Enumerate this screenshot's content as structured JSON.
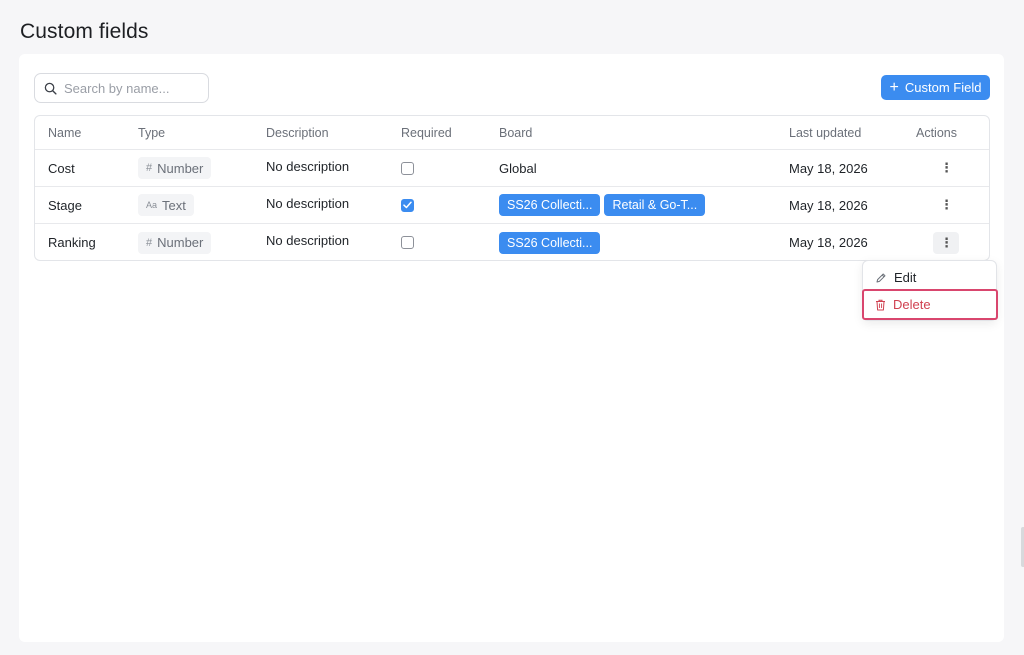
{
  "page": {
    "title": "Custom fields"
  },
  "toolbar": {
    "search_placeholder": "Search by name...",
    "add_button_label": "Custom Field"
  },
  "table": {
    "columns": {
      "name": "Name",
      "type": "Type",
      "description": "Description",
      "required": "Required",
      "board": "Board",
      "last_updated": "Last updated",
      "actions": "Actions"
    },
    "rows": [
      {
        "name": "Cost",
        "type": "Number",
        "type_icon": "#",
        "description": "No description",
        "required": false,
        "board": "Global",
        "board_tags": [],
        "last_updated": "May 18, 2026"
      },
      {
        "name": "Stage",
        "type": "Text",
        "type_icon": "Aa",
        "description": "No description",
        "required": true,
        "board": "",
        "board_tags": [
          "SS26 Collecti...",
          "Retail & Go-T..."
        ],
        "last_updated": "May 18, 2026"
      },
      {
        "name": "Ranking",
        "type": "Number",
        "type_icon": "#",
        "description": "No description",
        "required": false,
        "board": "",
        "board_tags": [
          "SS26 Collecti..."
        ],
        "last_updated": "May 18, 2026"
      }
    ]
  },
  "context_menu": {
    "edit_label": "Edit",
    "delete_label": "Delete"
  },
  "colors": {
    "accent": "#3b8cf0",
    "danger": "#d04050",
    "highlight": "#d9466e"
  }
}
